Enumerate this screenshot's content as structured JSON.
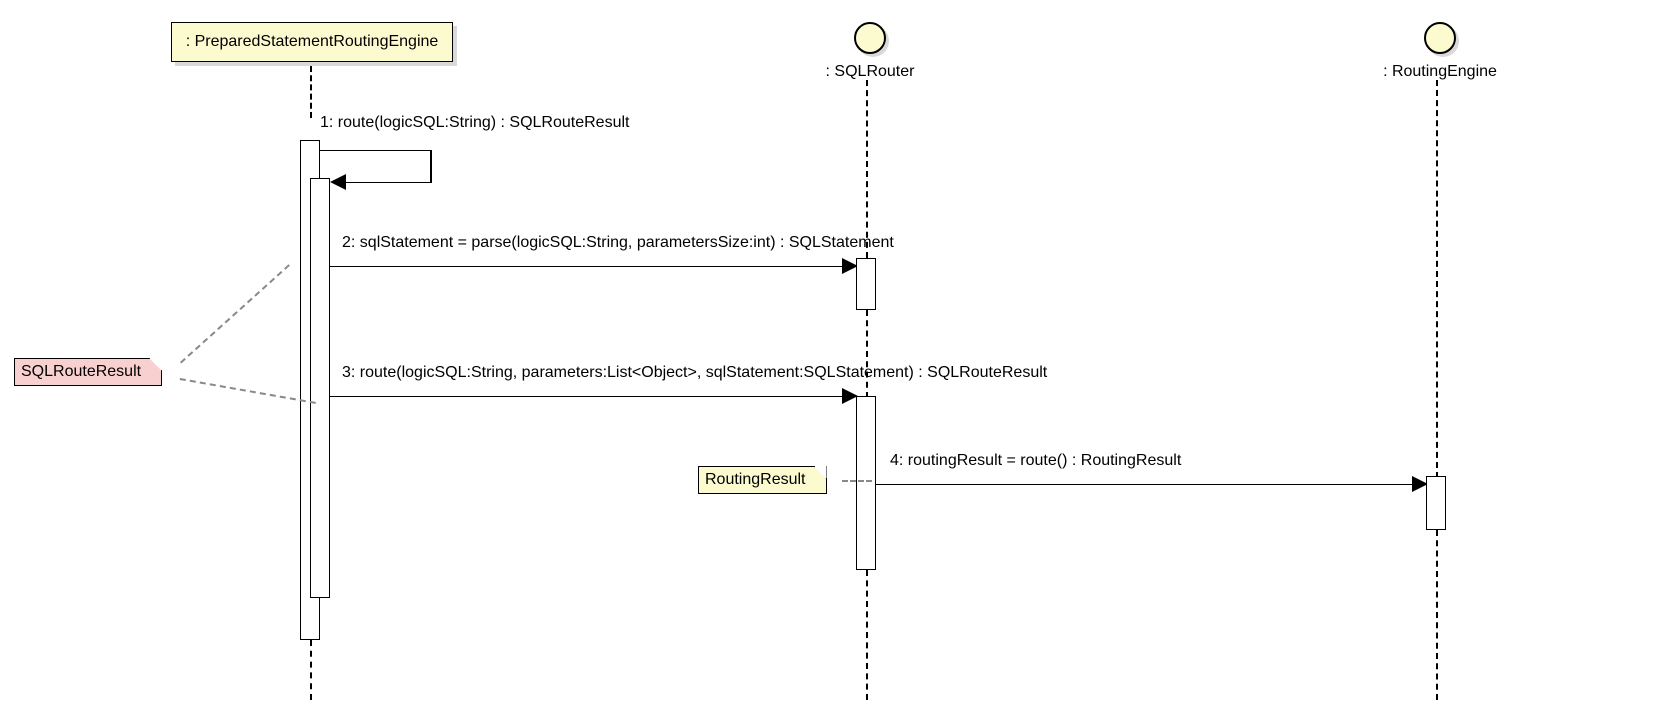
{
  "diagram_type": "UML Sequence Diagram",
  "lifelines": {
    "l1": {
      "label": ": PreparedStatementRoutingEngine"
    },
    "l2": {
      "label": ": SQLRouter"
    },
    "l3": {
      "label": ": RoutingEngine"
    }
  },
  "messages": {
    "m1": "1: route(logicSQL:String) : SQLRouteResult",
    "m2": "2: sqlStatement = parse(logicSQL:String, parametersSize:int) : SQLStatement",
    "m3": "3: route(logicSQL:String, parameters:List<Object>, sqlStatement:SQLStatement) : SQLRouteResult",
    "m4": "4: routingResult = route() : RoutingResult"
  },
  "notes": {
    "n1": "SQLRouteResult",
    "n2": "RoutingResult"
  }
}
